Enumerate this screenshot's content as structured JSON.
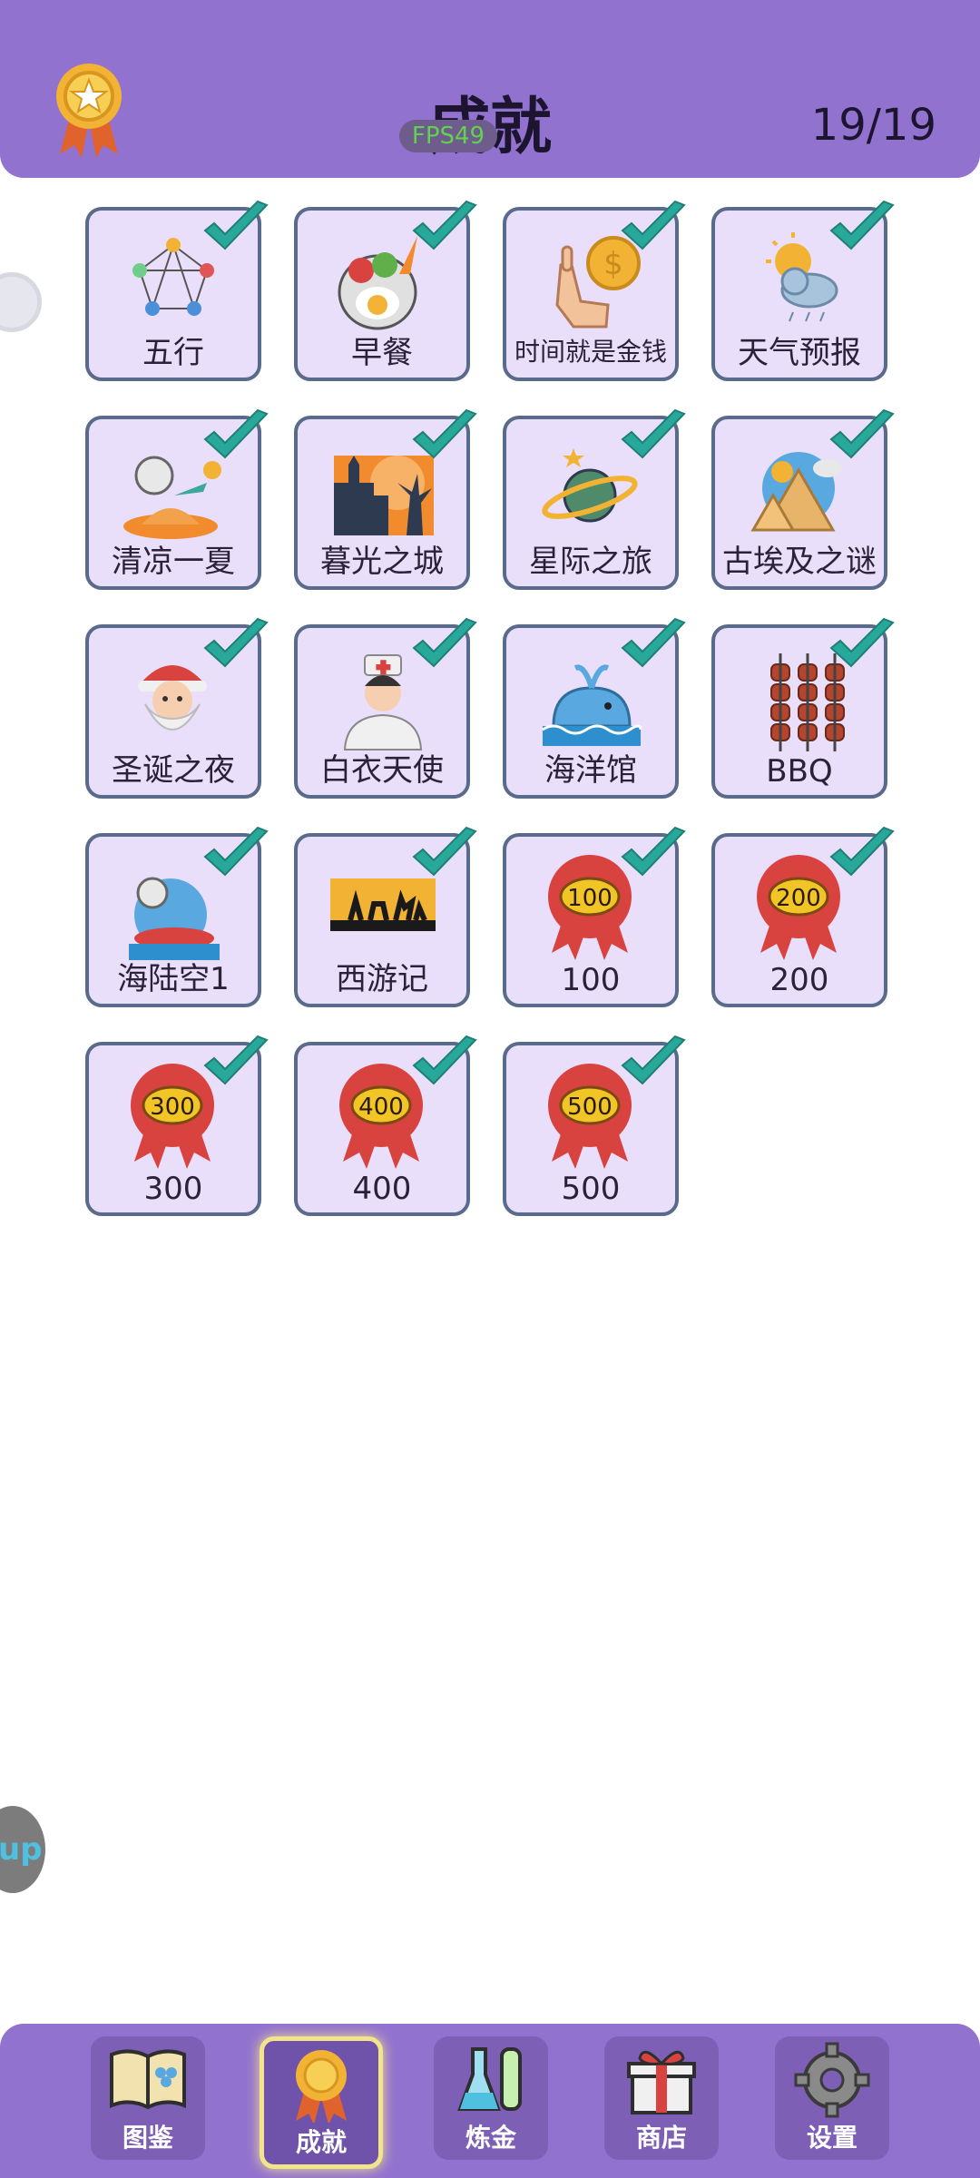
{
  "header": {
    "title": "成就",
    "fps": "FPS49",
    "count": "19/19"
  },
  "side": {
    "button_text": "up"
  },
  "achievements": [
    {
      "label": "五行",
      "icon": "five-elements-icon",
      "done": true
    },
    {
      "label": "早餐",
      "icon": "breakfast-icon",
      "done": true
    },
    {
      "label": "时间就是金钱",
      "icon": "time-money-icon",
      "done": true
    },
    {
      "label": "天气预报",
      "icon": "weather-icon",
      "done": true
    },
    {
      "label": "清凉一夏",
      "icon": "summer-beach-icon",
      "done": true
    },
    {
      "label": "暮光之城",
      "icon": "twilight-city-icon",
      "done": true
    },
    {
      "label": "星际之旅",
      "icon": "planet-icon",
      "done": true
    },
    {
      "label": "古埃及之谜",
      "icon": "pyramid-icon",
      "done": true
    },
    {
      "label": "圣诞之夜",
      "icon": "santa-icon",
      "done": true
    },
    {
      "label": "白衣天使",
      "icon": "nurse-icon",
      "done": true
    },
    {
      "label": "海洋馆",
      "icon": "whale-icon",
      "done": true
    },
    {
      "label": "BBQ",
      "icon": "skewers-icon",
      "done": true
    },
    {
      "label": "海陆空1",
      "icon": "sea-land-air-icon",
      "done": true
    },
    {
      "label": "西游记",
      "icon": "journey-west-icon",
      "done": true
    },
    {
      "label": "100",
      "icon": "ribbon-medal-icon",
      "badge": "100",
      "done": true
    },
    {
      "label": "200",
      "icon": "ribbon-medal-icon",
      "badge": "200",
      "done": true
    },
    {
      "label": "300",
      "icon": "ribbon-medal-icon",
      "badge": "300",
      "done": true
    },
    {
      "label": "400",
      "icon": "ribbon-medal-icon",
      "badge": "400",
      "done": true
    },
    {
      "label": "500",
      "icon": "ribbon-medal-icon",
      "badge": "500",
      "done": true
    }
  ],
  "nav": [
    {
      "label": "图鉴",
      "icon": "book-icon",
      "active": false
    },
    {
      "label": "成就",
      "icon": "medal-icon",
      "active": true
    },
    {
      "label": "炼金",
      "icon": "flask-icon",
      "active": false
    },
    {
      "label": "商店",
      "icon": "gift-icon",
      "active": false
    },
    {
      "label": "设置",
      "icon": "gear-icon",
      "active": false
    }
  ],
  "colors": {
    "header_bg": "#9272cf",
    "tile_bg": "#e9dffb",
    "tile_border": "#5a6a8a",
    "check": "#27a89a",
    "active_nav_border": "#f2e48a"
  }
}
